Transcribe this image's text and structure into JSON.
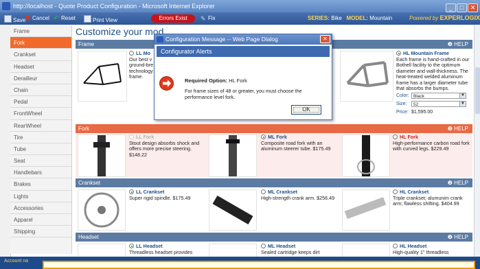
{
  "window": {
    "title": "http://localhost - Quote Product Configuration - Microsoft Internet Explorer"
  },
  "toolbar": {
    "save": "Save",
    "cancel": "Cancel",
    "reset": "Reset",
    "print_view": "Print View",
    "errors": "Errors Exist",
    "fix": "Fix",
    "series_label": "SERIES:",
    "series_value": "Bike",
    "model_label": "MODEL:",
    "model_value": "Mountain",
    "powered": "Powered by",
    "brand": "EXPERLOGIX"
  },
  "sidebar": {
    "items": [
      {
        "label": "Frame"
      },
      {
        "label": "Fork"
      },
      {
        "label": "Crankset"
      },
      {
        "label": "Headset"
      },
      {
        "label": "Derailleur"
      },
      {
        "label": "Chain"
      },
      {
        "label": "Pedal"
      },
      {
        "label": "FrontWheel"
      },
      {
        "label": "RearWheel"
      },
      {
        "label": "Tire"
      },
      {
        "label": "Tube"
      },
      {
        "label": "Seat"
      },
      {
        "label": "Handlebars"
      },
      {
        "label": "Brakes"
      },
      {
        "label": "Lights"
      },
      {
        "label": "Accessories"
      },
      {
        "label": "Apparel"
      },
      {
        "label": "Shipping"
      }
    ],
    "selected": "Fork"
  },
  "main": {
    "title": "Customize your mod",
    "help": "HELP",
    "frame": {
      "label": "Frame",
      "ll": {
        "name": "LL Mo",
        "desc": "Our best v ground-bre technology frame."
      },
      "hl": {
        "name": "HL Mountain Frame",
        "desc": "Each frame is hand-crafted in our Bothell facility to the optimum diameter and wall-thickness. The heat-treated welded aluminum frame has a larger diameter tube that absorbs the bumps.",
        "color_label": "Color:",
        "color_value": "Black",
        "size_label": "Size:",
        "size_value": "52",
        "price_label": "Price:",
        "price_value": "$1,595.00"
      }
    },
    "fork": {
      "label": "Fork",
      "ll": {
        "name": "LL Fork",
        "desc": "Stout design absorbs shock and offers more precise steering. $148.22"
      },
      "ml": {
        "name": "ML Fork",
        "desc": "Composite road fork with an aluminum steerer tube. $175.49"
      },
      "hl": {
        "name": "HL Fork",
        "desc": "High-performance carbon road fork with curved legs. $229.49"
      }
    },
    "crankset": {
      "label": "Crankset",
      "ll": {
        "name": "LL Crankset",
        "desc": "Super rigid spindle. $175.49"
      },
      "ml": {
        "name": "ML Crankset",
        "desc": "High-strength crank arm. $256.49"
      },
      "hl": {
        "name": "HL Crankset",
        "desc": "Triple crankset; alumunim crank arm; flawless shifting. $404.99"
      }
    },
    "headset": {
      "label": "Headset",
      "ll": {
        "name": "LL Headset",
        "desc": "Threadless headset provides"
      },
      "ml": {
        "name": "ML Headset",
        "desc": "Sealed cartridge keeps dirt"
      },
      "hl": {
        "name": "HL Headset",
        "desc": "High-quality 1\" threadless"
      }
    }
  },
  "dialog": {
    "title": "Configuration Message -- Web Page Dialog",
    "header": "Configurator Alerts",
    "required_label": "Required Option:",
    "required_value": "HL Fork",
    "message": "For frame sizes of 48 or greater, you must choose the performance level fork.",
    "ok": "OK"
  },
  "status": {
    "label": "Account na"
  },
  "colors": {
    "accent": "#f26a2b",
    "toolbar": "#2d5696",
    "fork_bg": "#fdecec",
    "error": "#c8121a"
  }
}
